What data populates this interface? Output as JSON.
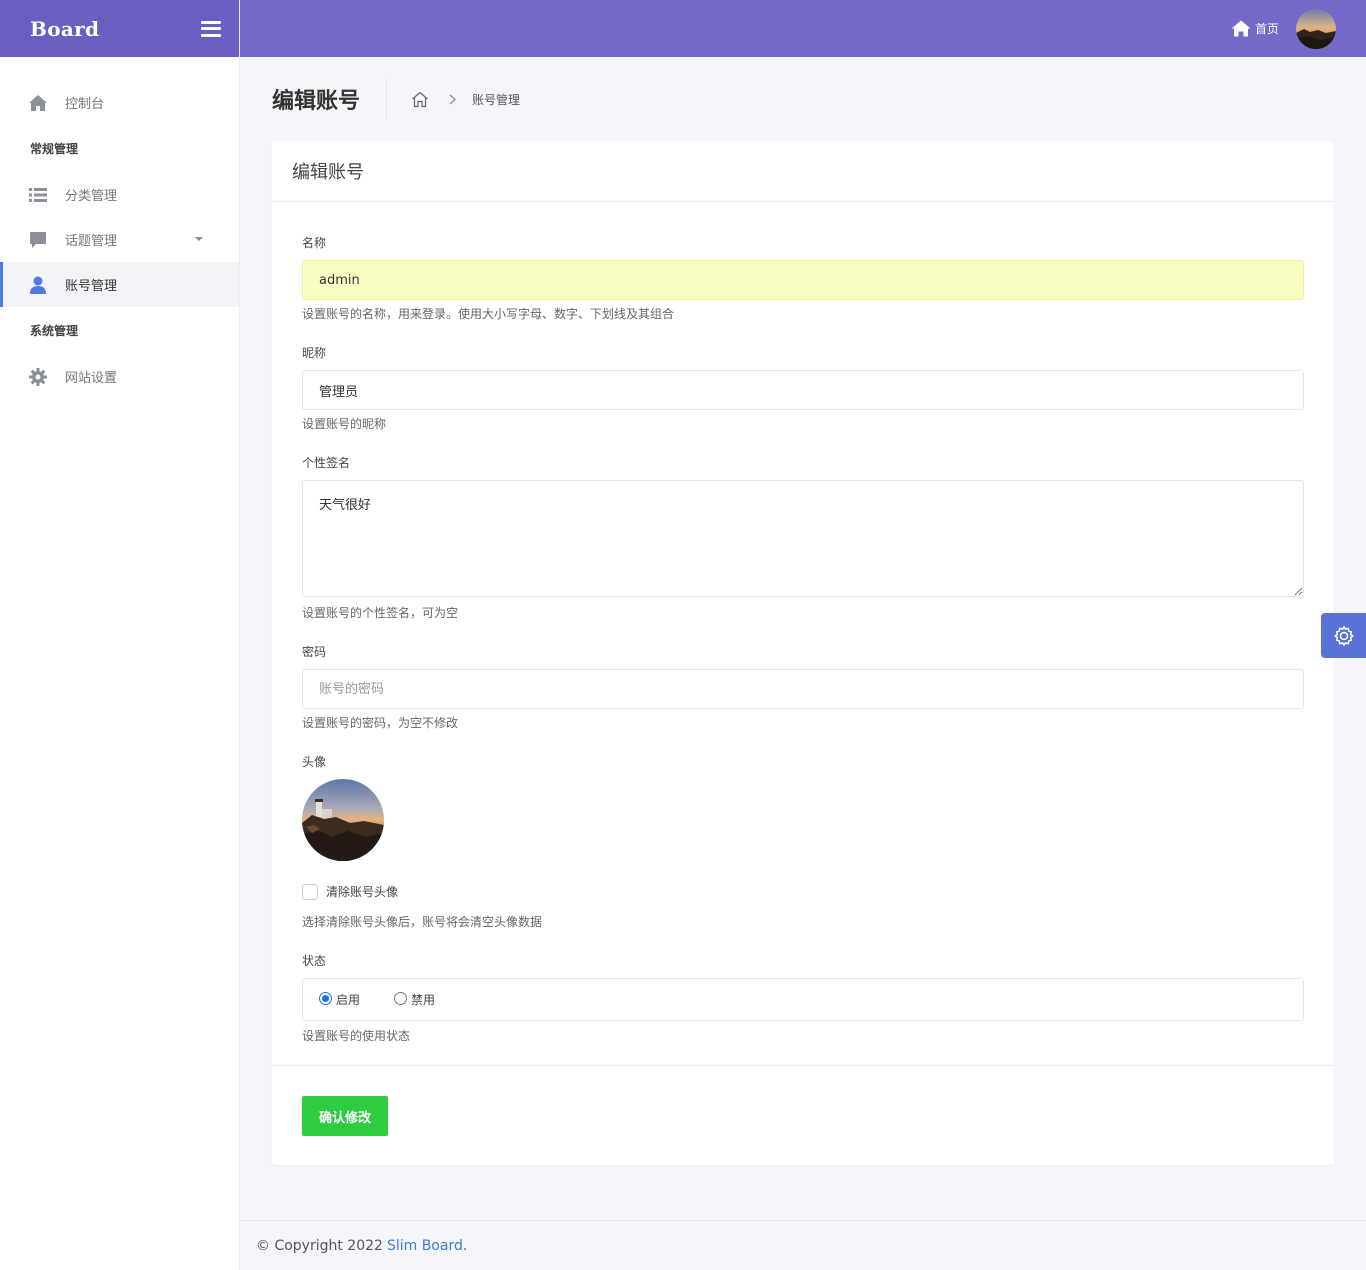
{
  "brand": {
    "logo": "Board"
  },
  "sidebar": {
    "items": [
      {
        "label": "控制台",
        "icon": "home-icon"
      },
      {
        "section": "常规管理"
      },
      {
        "label": "分类管理",
        "icon": "list-icon"
      },
      {
        "label": "话题管理",
        "icon": "comment-icon",
        "has_submenu": true
      },
      {
        "label": "账号管理",
        "icon": "user-icon",
        "active": true
      },
      {
        "section": "系统管理"
      },
      {
        "label": "网站设置",
        "icon": "gear-icon"
      }
    ],
    "dashboard": "控制台",
    "section_general": "常规管理",
    "category": "分类管理",
    "topic": "话题管理",
    "account": "账号管理",
    "section_system": "系统管理",
    "site_settings": "网站设置"
  },
  "topbar": {
    "home_label": "首页"
  },
  "page": {
    "title": "编辑账号",
    "breadcrumb_current": "账号管理"
  },
  "form": {
    "card_title": "编辑账号",
    "name": {
      "label": "名称",
      "value": "admin",
      "help": "设置账号的名称，用来登录。使用大小写字母、数字、下划线及其组合"
    },
    "nickname": {
      "label": "昵称",
      "value": "管理员",
      "help": "设置账号的昵称"
    },
    "signature": {
      "label": "个性签名",
      "value": "天气很好",
      "help": "设置账号的个性签名，可为空"
    },
    "password": {
      "label": "密码",
      "placeholder": "账号的密码",
      "help": "设置账号的密码，为空不修改"
    },
    "avatar": {
      "label": "头像",
      "clear_label": "清除账号头像",
      "clear_checked": false,
      "help": "选择清除账号头像后，账号将会清空头像数据"
    },
    "status": {
      "label": "状态",
      "options": [
        "启用",
        "禁用"
      ],
      "selected": "启用",
      "enable": "启用",
      "disable": "禁用",
      "help": "设置账号的使用状态"
    },
    "submit_label": "确认修改"
  },
  "footer": {
    "copyright": "© Copyright 2022",
    "link_text": "Slim Board",
    "suffix": "."
  },
  "colors": {
    "brand": "#6a5fc1",
    "topbar": "#7369c9",
    "active_indicator": "#4f7ae6",
    "submit": "#2ecc40",
    "link": "#3a7bd5",
    "fab": "#5a72d8"
  }
}
